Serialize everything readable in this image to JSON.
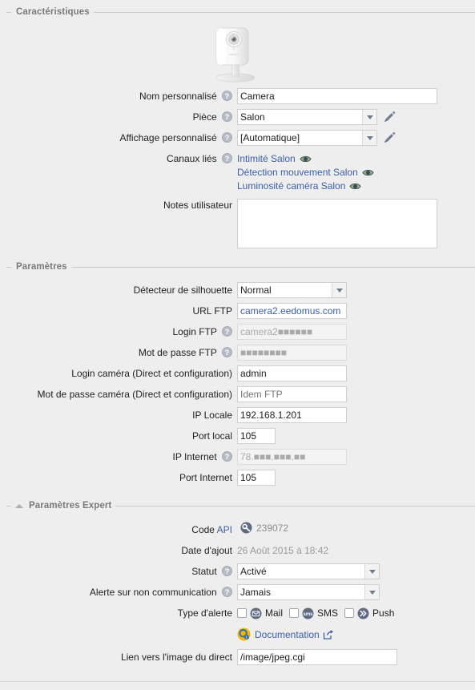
{
  "sections": {
    "characteristics": {
      "title": "Caractéristiques"
    },
    "parameters": {
      "title": "Paramètres"
    },
    "expert": {
      "title": "Paramètres Expert"
    }
  },
  "device": {
    "image_alt": "ip-camera-photo"
  },
  "characteristics": {
    "custom_name": {
      "label": "Nom personnalisé",
      "value": "Camera",
      "help": "?"
    },
    "room": {
      "label": "Pièce",
      "value": "Salon",
      "help": "?",
      "edit_icon": "pencil-icon"
    },
    "custom_display": {
      "label": "Affichage personnalisé",
      "value": "[Automatique]",
      "help": "?",
      "edit_icon": "pencil-icon"
    },
    "linked_channels": {
      "label": "Canaux liés",
      "help": "?",
      "items": [
        {
          "label": "Intimité Salon",
          "icon": "eye-icon"
        },
        {
          "label": "Détection mouvement Salon",
          "icon": "eye-icon"
        },
        {
          "label": "Luminosité caméra Salon",
          "icon": "eye-icon"
        }
      ]
    },
    "user_notes": {
      "label": "Notes utilisateur",
      "value": "",
      "placeholder": ""
    }
  },
  "parameters": {
    "silhouette_detector": {
      "label": "Détecteur de silhouette",
      "value": "Normal"
    },
    "ftp_url": {
      "label": "URL FTP",
      "value": "camera2.eedomus.com"
    },
    "ftp_login": {
      "label": "Login FTP",
      "help": "?",
      "value": "camera2■■■■■■",
      "disabled": true
    },
    "ftp_password": {
      "label": "Mot de passe FTP",
      "help": "?",
      "value": "■■■■■■■■",
      "disabled": true
    },
    "camera_login": {
      "label": "Login caméra (Direct et configuration)",
      "value": "admin"
    },
    "camera_password": {
      "label": "Mot de passe caméra (Direct et configuration)",
      "value": "",
      "placeholder": "Idem FTP"
    },
    "local_ip": {
      "label": "IP Locale",
      "value": "192.168.1.201"
    },
    "local_port": {
      "label": "Port local",
      "value": "105"
    },
    "internet_ip": {
      "label": "IP Internet",
      "help": "?",
      "value": "78.■■■.■■■.■■",
      "disabled": true
    },
    "internet_port": {
      "label": "Port Internet",
      "value": "105"
    }
  },
  "expert": {
    "api_code": {
      "label": "Code",
      "link_label": "API",
      "icon": "api-key-icon",
      "value": "239072"
    },
    "added_date": {
      "label": "Date d'ajout",
      "value": "26 Août 2015 à 18:42"
    },
    "status": {
      "label": "Statut",
      "help": "?",
      "value": "Activé"
    },
    "no_comm_alert": {
      "label": "Alerte sur non communication",
      "help": "?",
      "value": "Jamais"
    },
    "alert_type": {
      "label": "Type d'alerte",
      "options": [
        {
          "label": "Mail",
          "icon": "mail-icon",
          "checked": false
        },
        {
          "label": "SMS",
          "icon": "sms-icon",
          "checked": false
        },
        {
          "label": "Push",
          "icon": "push-icon",
          "checked": false
        }
      ]
    },
    "documentation": {
      "label": "Documentation",
      "icon": "documentation-icon",
      "external_icon": "external-link-icon"
    },
    "live_image_link": {
      "label": "Lien vers l'image du direct",
      "value": "/image/jpeg.cgi"
    }
  },
  "colors": {
    "background": "#eeeeee",
    "link": "#3b5ea8",
    "section_title": "#7a7a7a",
    "muted": "#9a9a9a",
    "input_border": "#cfcfcf"
  }
}
